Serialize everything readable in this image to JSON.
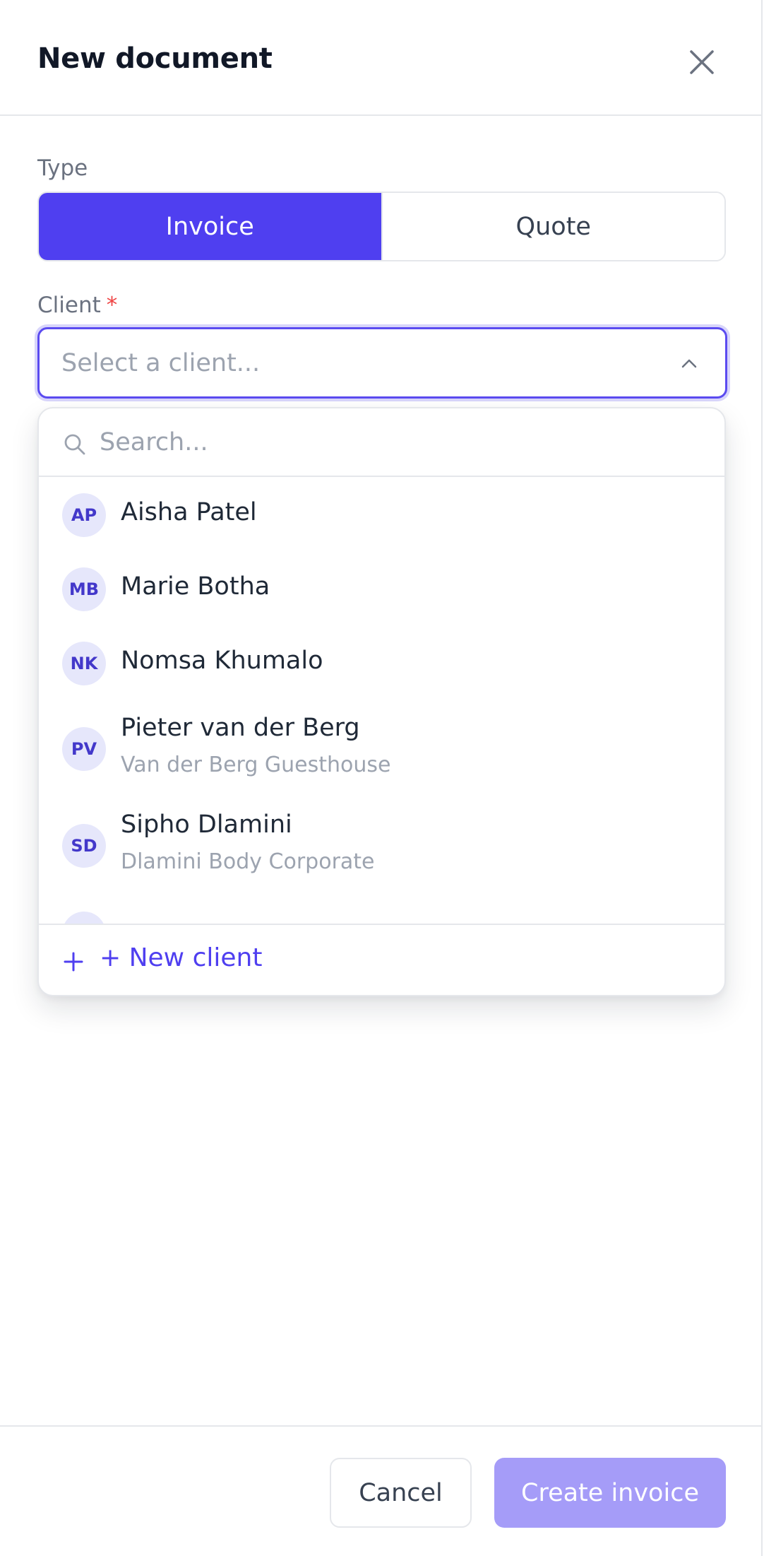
{
  "header": {
    "title": "New document"
  },
  "type_field": {
    "label": "Type",
    "options": [
      "Invoice",
      "Quote"
    ],
    "selected": "Invoice"
  },
  "client_field": {
    "label": "Client",
    "required_mark": "*",
    "placeholder": "Select a client..."
  },
  "dropdown": {
    "search_placeholder": "Search...",
    "clients": [
      {
        "initials": "AP",
        "name": "Aisha Patel",
        "company": ""
      },
      {
        "initials": "MB",
        "name": "Marie Botha",
        "company": ""
      },
      {
        "initials": "NK",
        "name": "Nomsa Khumalo",
        "company": ""
      },
      {
        "initials": "PV",
        "name": "Pieter van der Berg",
        "company": "Van der Berg Guesthouse"
      },
      {
        "initials": "SD",
        "name": "Sipho Dlamini",
        "company": "Dlamini Body Corporate"
      }
    ],
    "new_client_label": "+ New client"
  },
  "footer": {
    "cancel_label": "Cancel",
    "create_label": "Create invoice"
  },
  "colors": {
    "accent": "#4f3ff0",
    "accent_disabled": "#a59cf8",
    "required": "#ef4444",
    "avatar_bg": "#e6e7fb"
  },
  "icons": {
    "close": "close-icon",
    "chevron": "chevron-up-icon",
    "search": "search-icon",
    "plus": "plus-icon"
  }
}
